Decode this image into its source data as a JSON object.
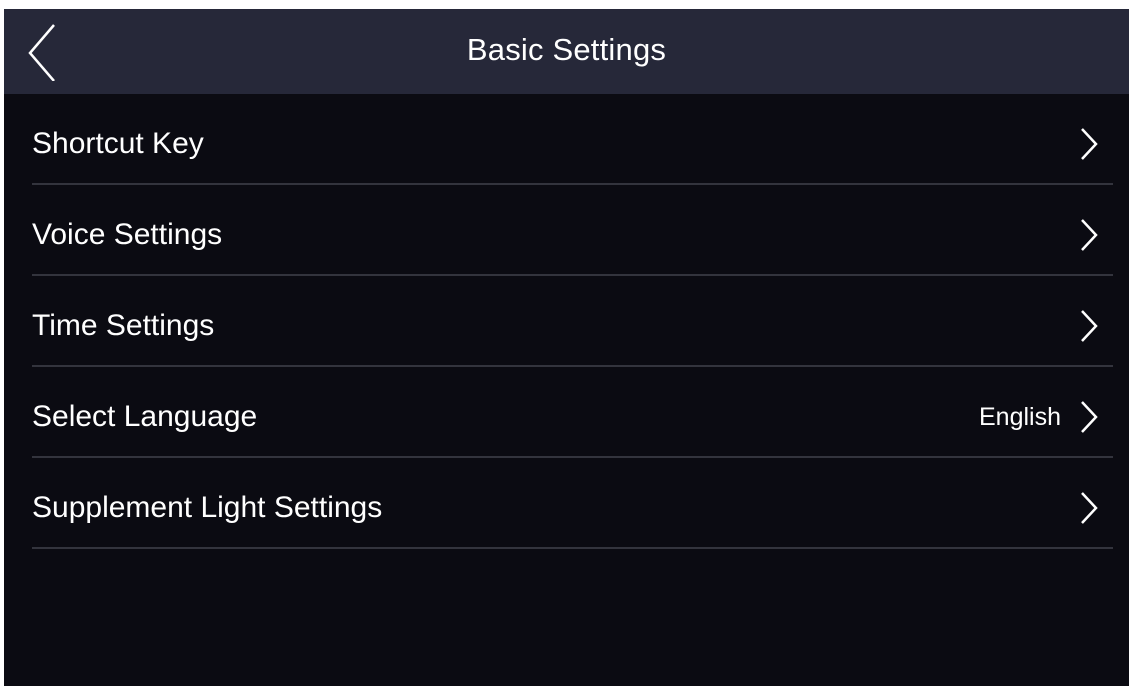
{
  "header": {
    "title": "Basic Settings",
    "back_icon": "chevron-left-icon"
  },
  "menu": {
    "items": [
      {
        "label": "Shortcut Key",
        "value": "",
        "icon": "chevron-right-icon"
      },
      {
        "label": "Voice Settings",
        "value": "",
        "icon": "chevron-right-icon"
      },
      {
        "label": "Time Settings",
        "value": "",
        "icon": "chevron-right-icon"
      },
      {
        "label": "Select Language",
        "value": "English",
        "icon": "chevron-right-icon"
      },
      {
        "label": "Supplement Light Settings",
        "value": "",
        "icon": "chevron-right-icon"
      }
    ]
  },
  "colors": {
    "background": "#0b0b12",
    "header_background": "#262839",
    "divider": "#33343d",
    "text": "#ffffff"
  }
}
